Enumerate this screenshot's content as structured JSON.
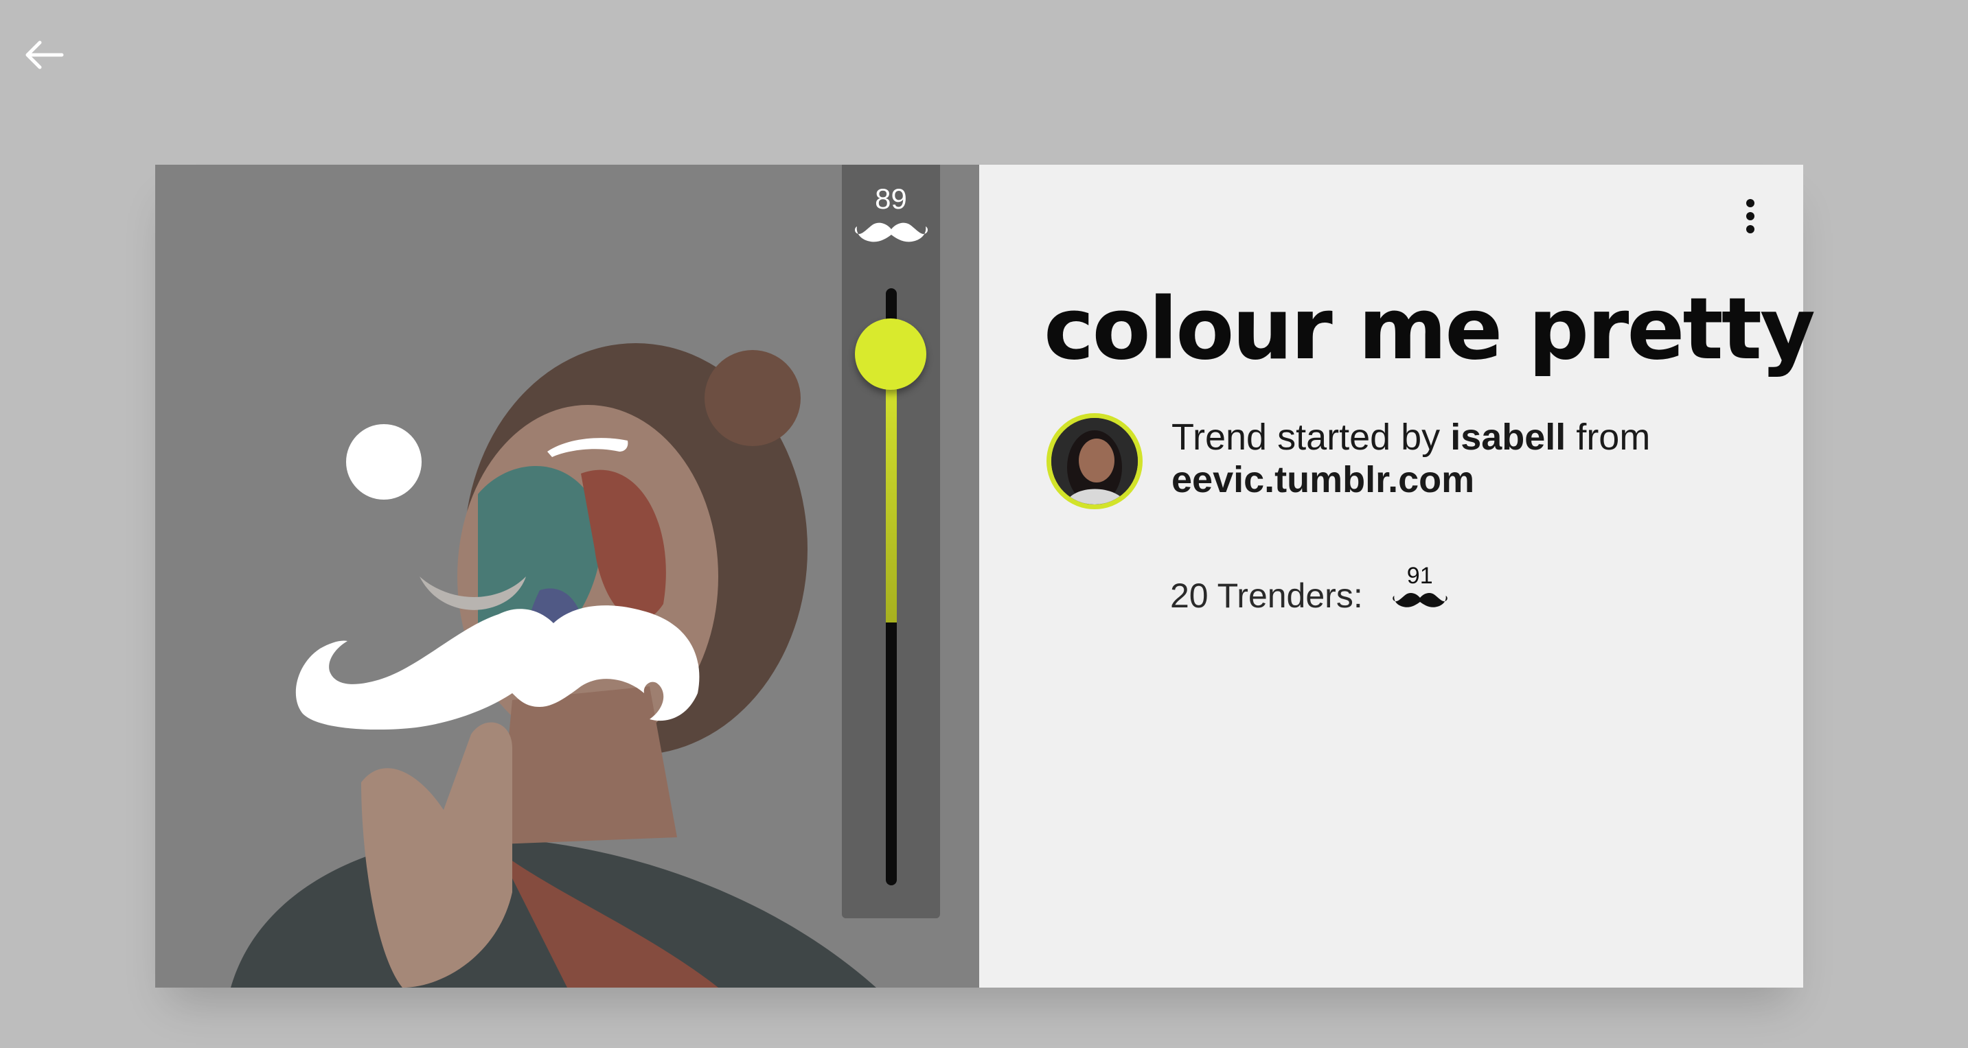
{
  "nav": {
    "back_icon": "arrow-left-icon"
  },
  "trend": {
    "title": "colour me pretty",
    "started_prefix": "Trend started by",
    "author": "isabell",
    "from_word": "from",
    "source": "eevic.tumblr.com"
  },
  "slider": {
    "value": "89",
    "level_fraction": 0.89,
    "icon": "mustache-icon"
  },
  "trenders": {
    "label": "20 Trenders:",
    "count": "91",
    "icon": "mustache-icon"
  },
  "menu": {
    "icon": "more-vertical-icon"
  },
  "colors": {
    "accent": "#d9ea2d",
    "background": "#bdbdbd",
    "panel": "#f0f0f0"
  }
}
